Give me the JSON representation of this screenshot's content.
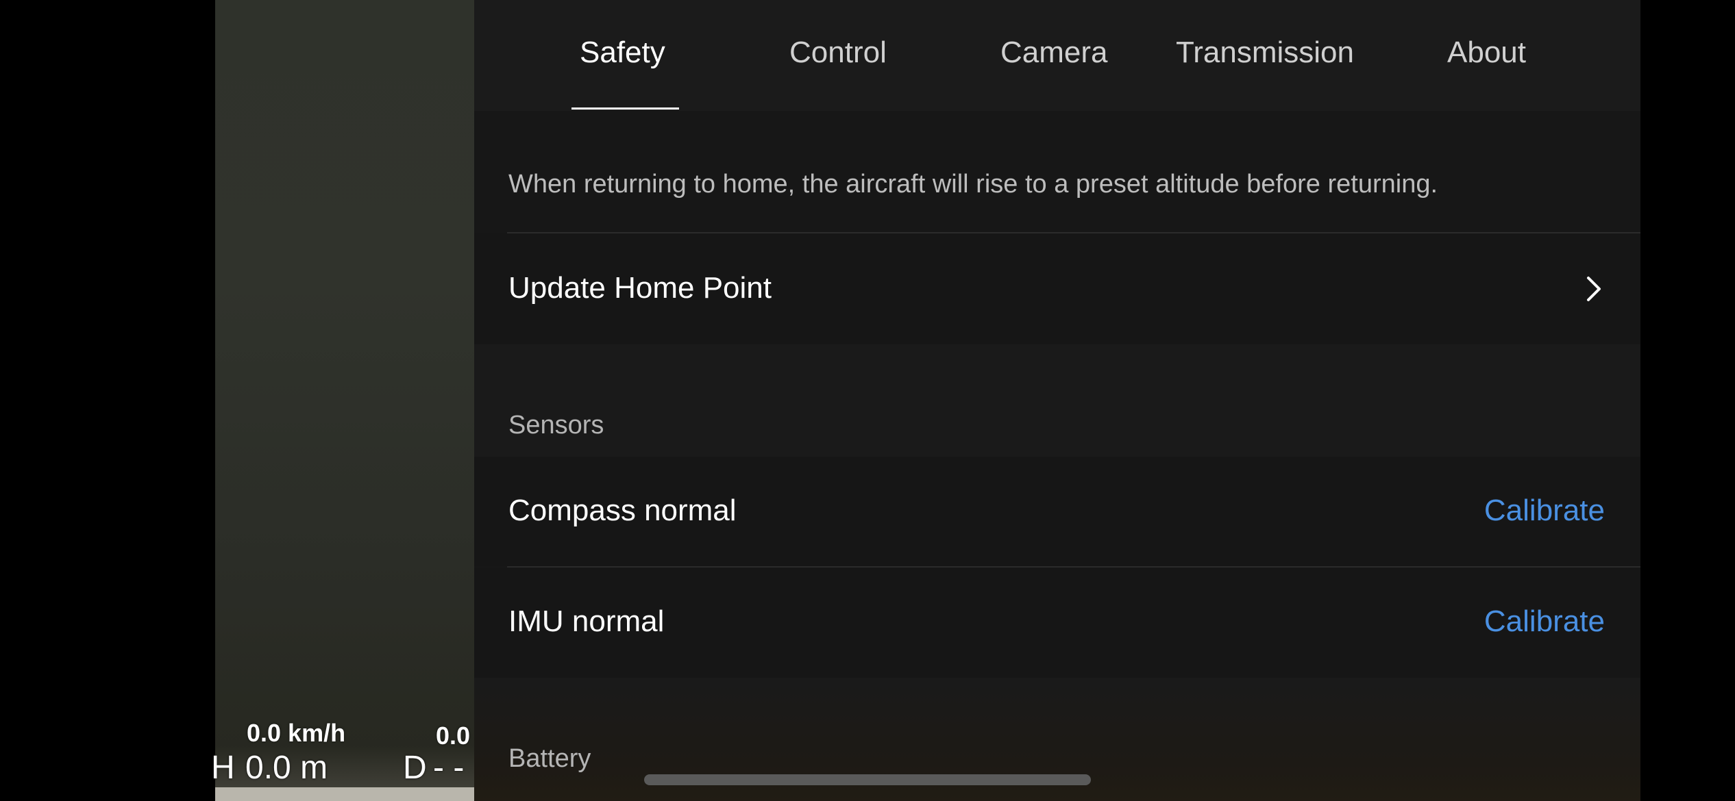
{
  "camera_feed": {
    "speed_label": "0.0 km/h",
    "speed2_label": "0.0",
    "height_prefix": "H",
    "height_value": "0.0 m",
    "distance_prefix": "D",
    "distance_value": "- -"
  },
  "tabs": [
    {
      "label": "Safety",
      "active": true
    },
    {
      "label": "Control",
      "active": false
    },
    {
      "label": "Camera",
      "active": false
    },
    {
      "label": "Transmission",
      "active": false
    },
    {
      "label": "About",
      "active": false
    }
  ],
  "safety": {
    "rth_description": "When returning to home, the aircraft will rise to a preset altitude before returning.",
    "update_home_point": "Update Home Point",
    "sensors_title": "Sensors",
    "compass_status": "Compass normal",
    "compass_action": "Calibrate",
    "imu_status": "IMU normal",
    "imu_action": "Calibrate",
    "battery_title": "Battery"
  },
  "colors": {
    "accent": "#4a90e2",
    "panel_bg": "#171717",
    "text_primary": "#ffffff",
    "text_secondary": "#bdbdbd"
  },
  "icons": {
    "update_home_point_chevron": "chevron-right-icon"
  }
}
